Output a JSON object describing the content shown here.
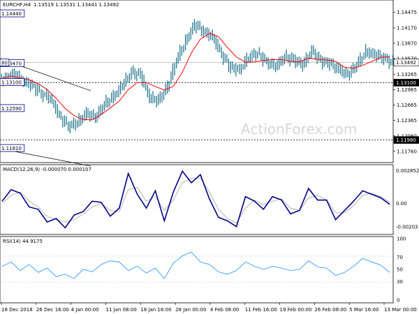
{
  "window": {
    "symbol": "EURCHF,H4",
    "ohlc": "1.13519 1.13531 1.13441 1.13492",
    "watermark": "ActionForex.com"
  },
  "colors": {
    "bar": "#1a6f8a",
    "ma": "#ff0000",
    "macd": "#00008b",
    "signal": "#a0a0a0",
    "rsi": "#1e90ff",
    "trendline": "#000000"
  },
  "chart_data": [
    {
      "type": "candlestick",
      "title": "EURCHF,H4 1.13519 1.13531 1.13441 1.13492",
      "ylim": [
        1.1158,
        1.1466
      ],
      "y_ticks": [
        "1.14475",
        "1.14170",
        "1.13870",
        "1.13570",
        "1.13265",
        "1.12965",
        "1.12665",
        "1.12365",
        "1.12060",
        "1.11760"
      ],
      "price_labels": [
        {
          "text": "1.13492",
          "value": 1.13492
        },
        {
          "text": "1.13100",
          "value": 1.131
        },
        {
          "text": "1.11980",
          "value": 1.1198
        }
      ],
      "annotations": [
        {
          "text": "1.14440",
          "x": "31 Jan",
          "value": 1.1444
        },
        {
          "text": "1.13470",
          "x": "15 Jan",
          "value": 1.1347
        },
        {
          "text": "1.12590",
          "x": "23 Jan",
          "value": 1.1259
        },
        {
          "text": "1.13100",
          "x": "8 Feb",
          "value": 1.131
        },
        {
          "text": "1.11810",
          "x": "3 Jan",
          "value": 1.1181
        },
        {
          "text": "80",
          "x": "18 Dec",
          "value": 1.1348
        }
      ],
      "levels": [
        1.131,
        1.1198
      ],
      "series": [
        {
          "name": "Close",
          "x": [
            "18 Dec",
            "20 Dec",
            "22 Dec",
            "24 Dec",
            "26 Dec",
            "28 Dec",
            "31 Dec",
            "2 Jan",
            "4 Jan",
            "6 Jan",
            "8 Jan",
            "10 Jan",
            "12 Jan",
            "14 Jan",
            "16 Jan",
            "18 Jan",
            "20 Jan",
            "22 Jan",
            "24 Jan",
            "26 Jan",
            "28 Jan",
            "30 Jan",
            "1 Feb",
            "3 Feb",
            "5 Feb",
            "7 Feb",
            "9 Feb",
            "11 Feb",
            "13 Feb",
            "15 Feb",
            "17 Feb",
            "19 Feb",
            "21 Feb",
            "23 Feb",
            "25 Feb",
            "27 Feb",
            "1 Mar",
            "3 Mar",
            "5 Mar",
            "7 Mar",
            "9 Mar",
            "11 Mar",
            "13 Mar",
            "15 Mar"
          ],
          "values": [
            1.1318,
            1.1328,
            1.1312,
            1.1305,
            1.1288,
            1.128,
            1.1245,
            1.1225,
            1.1232,
            1.125,
            1.1242,
            1.1268,
            1.1282,
            1.1305,
            1.133,
            1.1325,
            1.128,
            1.1275,
            1.1302,
            1.1355,
            1.139,
            1.1425,
            1.141,
            1.14,
            1.1365,
            1.134,
            1.1335,
            1.136,
            1.1368,
            1.135,
            1.1342,
            1.136,
            1.1355,
            1.1345,
            1.1372,
            1.1352,
            1.1348,
            1.1335,
            1.1325,
            1.1345,
            1.137,
            1.1365,
            1.1358,
            1.1349
          ]
        }
      ]
    },
    {
      "type": "line",
      "title": "MACD(12,26,9) -0.000070 0.000107",
      "ylim": [
        -0.0025,
        0.003
      ],
      "y_ticks": [
        "0.002852",
        "0.00",
        "-0.00203"
      ],
      "series": [
        {
          "name": "MACD",
          "values": [
            0.0002,
            0.0012,
            0.0009,
            -0.0003,
            -0.0005,
            -0.0016,
            -0.0013,
            -0.0021,
            -0.001,
            -0.0007,
            0.0002,
            0.0001,
            -0.0011,
            -0.0004,
            0.0026,
            0.0008,
            -0.0004,
            0.0011,
            -0.0015,
            0.001,
            0.0028,
            0.0018,
            0.0025,
            0.0004,
            -0.0012,
            -0.0015,
            -0.002,
            0.0006,
            0.0002,
            -0.0005,
            0.0006,
            0.0003,
            -0.0009,
            -0.0006,
            0.0013,
            0.0003,
            0.0003,
            -0.0014,
            -0.0006,
            0.0002,
            0.0011,
            0.0008,
            0.0005,
            -7e-05
          ]
        },
        {
          "name": "Signal",
          "values": [
            0.0,
            0.0007,
            0.001,
            0.0002,
            -0.0003,
            -0.0011,
            -0.0014,
            -0.0016,
            -0.0014,
            -0.0009,
            -0.0003,
            0.0,
            -0.0006,
            -0.0007,
            0.0012,
            0.0014,
            0.0002,
            0.0006,
            -0.0006,
            0.0003,
            0.0018,
            0.0022,
            0.0022,
            0.001,
            -0.0005,
            -0.0013,
            -0.0017,
            -0.0004,
            0.0003,
            -0.0001,
            0.0002,
            0.0004,
            -0.0004,
            -0.0006,
            0.0005,
            0.0007,
            0.0003,
            -0.0008,
            -0.0008,
            -0.0002,
            0.0007,
            0.0009,
            0.0006,
            0.000107
          ]
        }
      ]
    },
    {
      "type": "line",
      "title": "RSI(14) 44.9175",
      "ylim": [
        0,
        100
      ],
      "y_ticks": [
        "100",
        "70",
        "50",
        "30",
        "0"
      ],
      "series": [
        {
          "name": "RSI",
          "values": [
            55,
            62,
            48,
            58,
            45,
            52,
            38,
            42,
            35,
            50,
            46,
            58,
            64,
            62,
            48,
            55,
            44,
            52,
            35,
            60,
            72,
            78,
            62,
            58,
            46,
            42,
            48,
            62,
            55,
            50,
            55,
            52,
            48,
            50,
            64,
            54,
            52,
            40,
            45,
            55,
            68,
            62,
            57,
            44.9
          ]
        }
      ]
    }
  ],
  "x_axis_labels": [
    "18 Dec 2018",
    "26 Dec 16:00",
    "4 Jan 00:00",
    "11 Jan 08:00",
    "18 Jan 16:00",
    "28 Jan 00:00",
    "4 Feb 08:00",
    "11 Feb 16:00",
    "19 Feb 00:00",
    "26 Feb 08:00",
    "5 Mar 16:00",
    "13 Mar 00:00"
  ]
}
